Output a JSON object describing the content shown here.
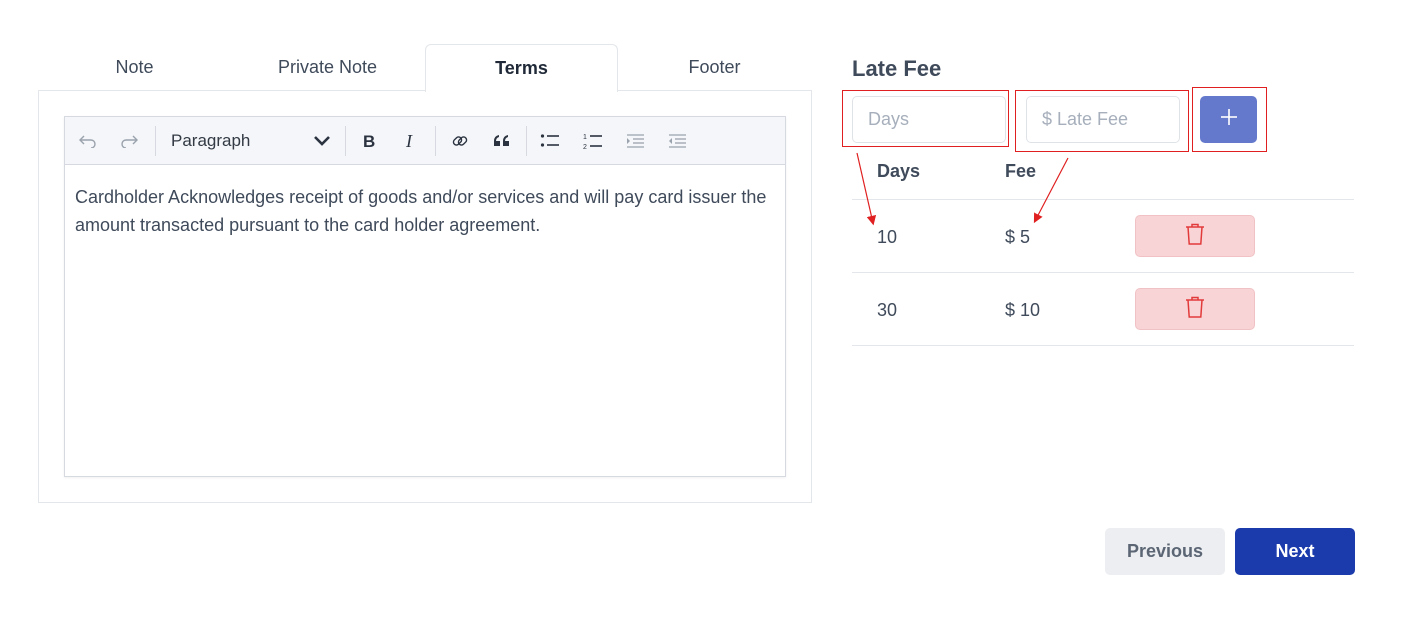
{
  "tabs": {
    "items": [
      {
        "label": "Note"
      },
      {
        "label": "Private Note"
      },
      {
        "label": "Terms"
      },
      {
        "label": "Footer"
      }
    ],
    "active": "Terms"
  },
  "editor": {
    "toolbar": {
      "paragraph_style": "Paragraph",
      "icons": [
        "undo-icon",
        "redo-icon",
        "chevron-down-icon",
        "bold-icon",
        "italic-icon",
        "link-icon",
        "blockquote-icon",
        "bulleted-list-icon",
        "numbered-list-icon",
        "indent-icon",
        "outdent-icon"
      ]
    },
    "content": "Cardholder Acknowledges receipt of goods and/or services and will pay card issuer the amount transacted pursuant to the card holder agreement."
  },
  "late_fee": {
    "title": "Late Fee",
    "days_placeholder": "Days",
    "fee_placeholder": "$ Late Fee",
    "add_icon": "plus-icon",
    "columns": {
      "days": "Days",
      "fee": "Fee"
    },
    "rows": [
      {
        "days": "10",
        "fee": "$ 5"
      },
      {
        "days": "30",
        "fee": "$ 10"
      }
    ],
    "delete_icon": "trash-icon"
  },
  "actions": {
    "previous": "Previous",
    "next": "Next"
  },
  "colors": {
    "primary": "#1b3aab",
    "add_button": "#6479cc",
    "delete_bg": "#f8d4d6",
    "delete_icon": "#e23a3a",
    "annotation": "#e02020"
  }
}
